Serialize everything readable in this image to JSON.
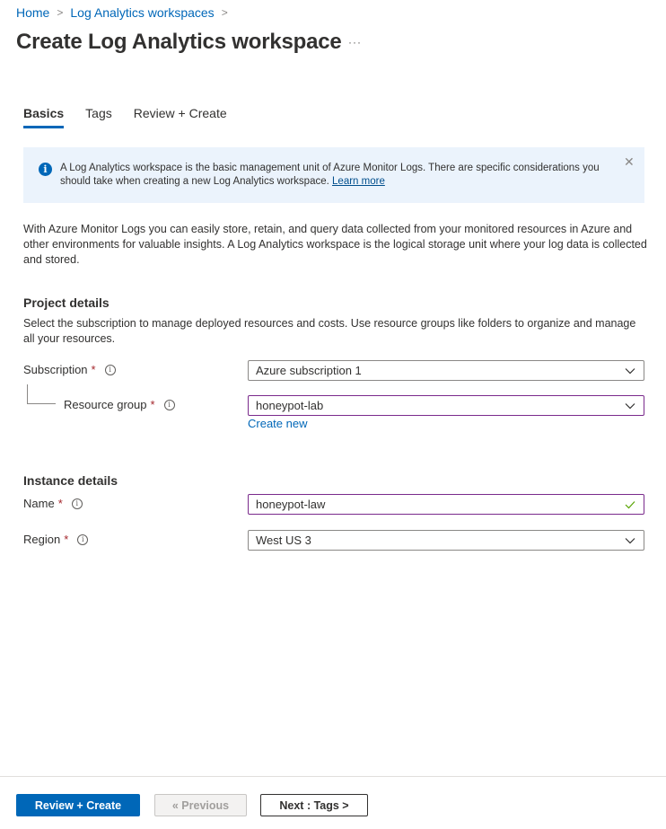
{
  "breadcrumb": [
    {
      "label": "Home"
    },
    {
      "label": "Log Analytics workspaces"
    }
  ],
  "page_title": "Create Log Analytics workspace",
  "more_label": "···",
  "tabs": [
    {
      "label": "Basics",
      "active": true
    },
    {
      "label": "Tags",
      "active": false
    },
    {
      "label": "Review + Create",
      "active": false
    }
  ],
  "banner": {
    "text": "A Log Analytics workspace is the basic management unit of Azure Monitor Logs. There are specific considerations you should take when creating a new Log Analytics workspace.",
    "link": "Learn more",
    "icon": "info-icon",
    "close_icon": "close-icon"
  },
  "description": "With Azure Monitor Logs you can easily store, retain, and query data collected from your monitored resources in Azure and other environments for valuable insights. A Log Analytics workspace is the logical storage unit where your log data is collected and stored.",
  "project_details": {
    "title": "Project details",
    "description": "Select the subscription to manage deployed resources and costs. Use resource groups like folders to organize and manage all your resources.",
    "subscription": {
      "label": "Subscription",
      "required": "*",
      "value": "Azure subscription 1"
    },
    "resource_group": {
      "label": "Resource group",
      "required": "*",
      "value": "honeypot-lab",
      "create_new": "Create new"
    }
  },
  "instance_details": {
    "title": "Instance details",
    "name": {
      "label": "Name",
      "required": "*",
      "value": "honeypot-law",
      "valid": true
    },
    "region": {
      "label": "Region",
      "required": "*",
      "value": "West US 3"
    }
  },
  "footer": {
    "review_create": "Review + Create",
    "previous": "« Previous",
    "next": "Next : Tags >"
  },
  "colors": {
    "accent": "#0067b8",
    "focus_border": "#7a2a8c",
    "banner_bg": "#ebf3fc",
    "required": "#a4262c",
    "valid_check": "#57a300"
  }
}
